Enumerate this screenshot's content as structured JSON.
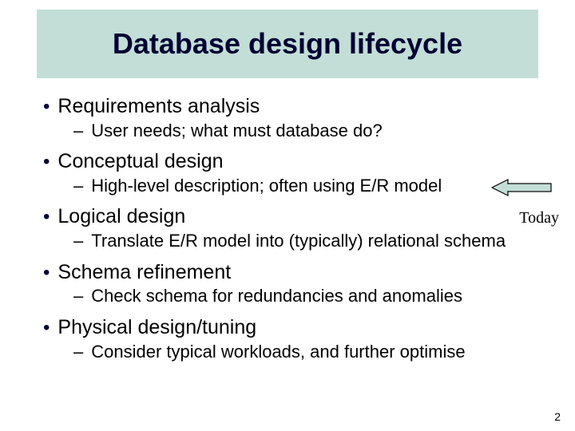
{
  "title": "Database design lifecycle",
  "items": {
    "l1a": "Requirements analysis",
    "l2a": "User needs; what must database do?",
    "l1b": "Conceptual design",
    "l2b": "High-level description; often using E/R model",
    "l1c": "Logical design",
    "l2c": "Translate E/R model into (typically) relational schema",
    "l1d": "Schema refinement",
    "l2d": "Check schema for redundancies and anomalies",
    "l1e": "Physical design/tuning",
    "l2e": "Consider typical workloads, and further optimise"
  },
  "annotation": "Today",
  "page_number": "2",
  "colors": {
    "title_bg": "#c3ded7",
    "title_fg": "#000033"
  }
}
